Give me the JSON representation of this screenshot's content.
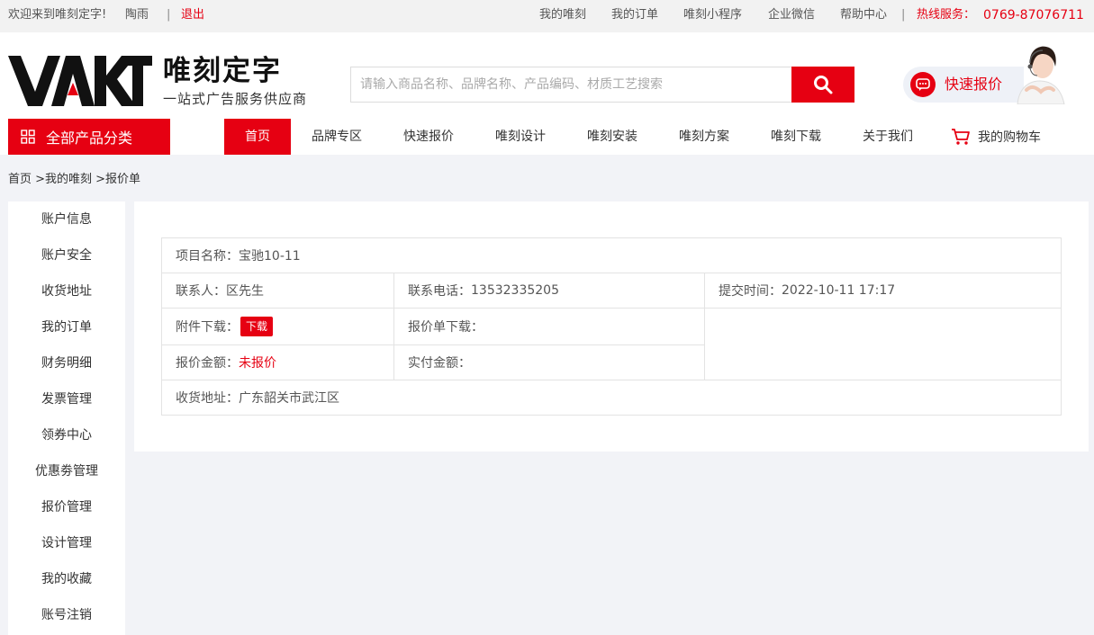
{
  "topbar": {
    "welcome": "欢迎来到唯刻定字!",
    "username": "陶雨",
    "separator": "|",
    "logout": "退出",
    "links": [
      "我的唯刻",
      "我的订单",
      "唯刻小程序",
      "企业微信",
      "帮助中心"
    ],
    "hotline_label": "热线服务：",
    "hotline_number": "0769-87076711"
  },
  "header": {
    "logo_text": "VAKT",
    "brand_title": "唯刻定字",
    "brand_subtitle": "一站式广告服务供应商",
    "search_placeholder": "请输入商品名称、品牌名称、产品编码、材质工艺搜索",
    "search_value": "",
    "quick_quote": "快速报价"
  },
  "nav": {
    "category_button": "全部产品分类",
    "items": [
      "首页",
      "品牌专区",
      "快速报价",
      "唯刻设计",
      "唯刻安装",
      "唯刻方案",
      "唯刻下载",
      "关于我们"
    ],
    "active_index": 0,
    "cart": "我的购物车"
  },
  "breadcrumb": "首页 >我的唯刻 >报价单",
  "sidebar": {
    "items": [
      "账户信息",
      "账户安全",
      "收货地址",
      "我的订单",
      "财务明细",
      "发票管理",
      "领券中心",
      "优惠劵管理",
      "报价管理",
      "设计管理",
      "我的收藏",
      "账号注销"
    ]
  },
  "quote": {
    "project_label": "项目名称：",
    "project_value": "宝驰10-11",
    "contact_label": "联系人：",
    "contact_value": "区先生",
    "phone_label": "联系电话：",
    "phone_value": "13532335205",
    "submit_label": "提交时间：",
    "submit_value": "2022-10-11 17:17",
    "attachment_label": "附件下载：",
    "attachment_button": "下载",
    "quote_download_label": "报价单下载：",
    "amount_label": "报价金额：",
    "amount_value": "未报价",
    "paid_label": "实付金额：",
    "address_label": "收货地址：",
    "address_value": "广东韶关市武江区"
  },
  "colors": {
    "accent": "#e60012",
    "background": "#f2f3f7",
    "topbar": "#f2f2f2"
  }
}
